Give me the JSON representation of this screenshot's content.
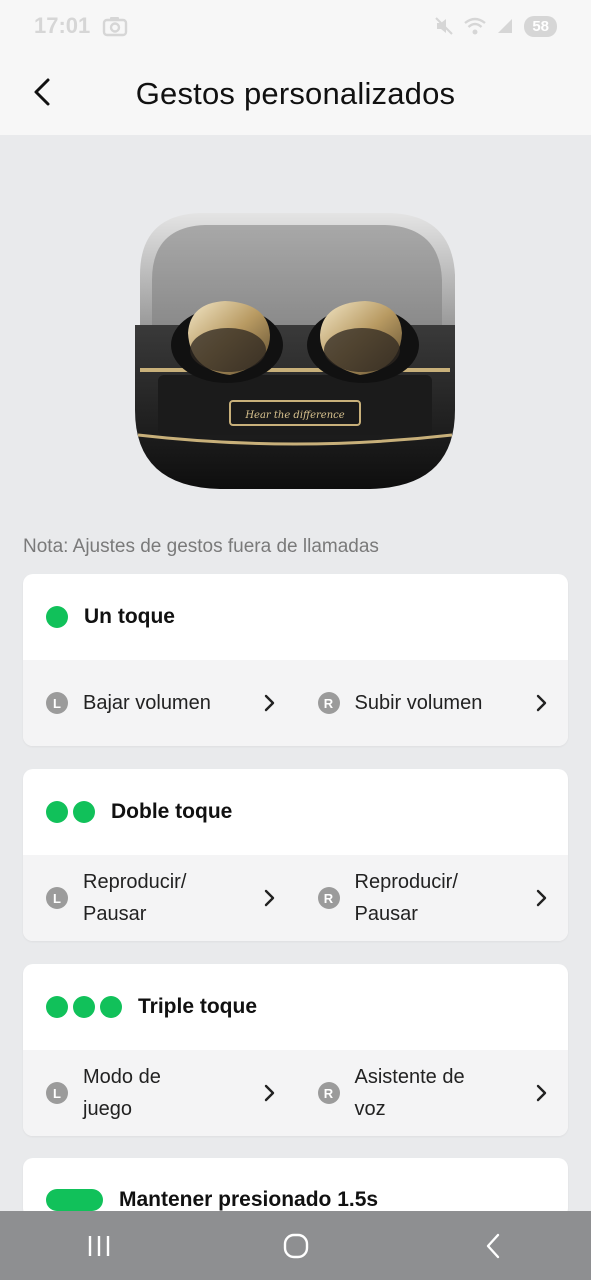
{
  "status_bar": {
    "time": "17:01",
    "battery": "58"
  },
  "header": {
    "title": "Gestos personalizados"
  },
  "note": "Nota: Ajustes de gestos fuera de llamadas",
  "gestures": [
    {
      "title": "Un toque",
      "left_badge": "L",
      "left_action": "Bajar volumen",
      "right_badge": "R",
      "right_action": "Subir volumen"
    },
    {
      "title": "Doble toque",
      "left_badge": "L",
      "left_action": "Reproducir/ Pausar",
      "right_badge": "R",
      "right_action": "Reproducir/ Pausar"
    },
    {
      "title": "Triple toque",
      "left_badge": "L",
      "left_action": "Modo de juego",
      "right_badge": "R",
      "right_action": "Asistente de voz"
    },
    {
      "title": "Mantener presionado 1.5s"
    }
  ],
  "product": {
    "plate_text": "Hear the difference"
  },
  "colors": {
    "accent": "#11c15a",
    "background": "#e9eaec",
    "nav_bar": "#8e8f91"
  },
  "icons": {
    "back": "chevron-left-icon",
    "action": "chevron-right-icon"
  }
}
